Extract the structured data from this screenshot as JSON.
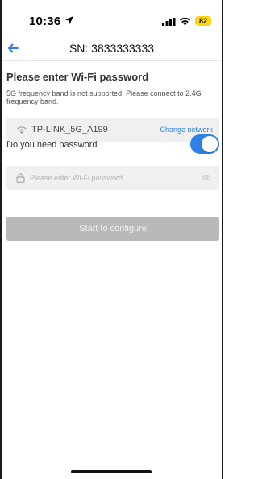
{
  "status_bar": {
    "time": "10:36",
    "battery": "82",
    "icons": [
      "location-arrow-icon",
      "signal-bars-icon",
      "wifi-icon",
      "battery-icon"
    ]
  },
  "nav": {
    "title": "SN: 3833333333",
    "back_icon": "back-arrow-icon"
  },
  "content": {
    "heading": "Please enter Wi-Fi password",
    "subtext": "5G frequency band is not supported. Please connect to 2.4G frequency band.",
    "network": {
      "ssid": "TP-LINK_5G_A199",
      "change_label": "Change network",
      "icon": "wifi-icon"
    },
    "password_toggle": {
      "label": "Do you need password",
      "on": true
    },
    "password_input": {
      "placeholder": "Please enter Wi-Fi password",
      "value": "",
      "icons": [
        "lock-icon",
        "eye-icon"
      ]
    },
    "start_button": {
      "label": "Start to configure",
      "enabled": false
    }
  },
  "colors": {
    "accent": "#2f7fe6",
    "battery": "#ffd60a",
    "input_bg": "#f0f0f0",
    "disabled_button": "#b9b9b9"
  }
}
